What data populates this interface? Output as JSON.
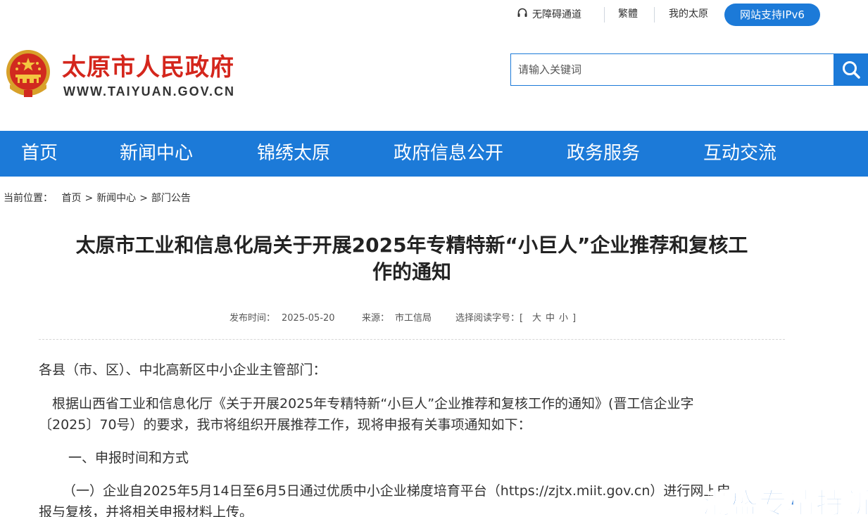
{
  "topbar": {
    "accessibility": "无障碍通道",
    "traditional": "繁體",
    "my_city": "我的太原",
    "ipv6": "网站支持IPv6"
  },
  "header": {
    "site_name": "太原市人民政府",
    "site_url": "WWW.TAIYUAN.GOV.CN"
  },
  "search": {
    "placeholder": "请输入关键词"
  },
  "nav": {
    "items": [
      {
        "label": "首页"
      },
      {
        "label": "新闻中心"
      },
      {
        "label": "锦绣太原"
      },
      {
        "label": "政府信息公开"
      },
      {
        "label": "政务服务"
      },
      {
        "label": "互动交流"
      }
    ]
  },
  "breadcrumb": {
    "prefix": "当前位置：",
    "items": [
      "首页",
      "新闻中心",
      "部门公告"
    ],
    "separator": ">"
  },
  "article": {
    "title_line1": "太原市工业和信息化局关于开展2025年专精特新“小巨人”企业推荐和复核工",
    "title_line2": "作的通知",
    "meta": {
      "date_label": "发布时间：",
      "date": "2025-05-20",
      "source_label": "来源：",
      "source": "市工信局",
      "font_label": "选择阅读字号：[",
      "font_large": "大",
      "font_medium": "中",
      "font_small": "小",
      "font_close": "]"
    },
    "salutation": "各县（市、区）、中北高新区中小企业主管部门：",
    "para1_line1": "根据山西省工业和信息化厅《关于开展2025年专精特新“小巨人”企业推荐和复核工作的通知》(晋工信企业字",
    "para1_line2": "〔2025〕70号）的要求，我市将组织开展推荐工作，现将申报有关事项通知如下：",
    "section1": "一、申报时间和方式",
    "para2_line1": "（一）企业自2025年5月14日至6月5日通过优质中小企业梯度培育平台（https://zjtx.miit.gov.cn）进行网上申",
    "para2_line2": "报与复核，并将相关申报材料上传。"
  },
  "watermark": "潮盛专精特新",
  "colors": {
    "brand_blue": "#1c7ad8",
    "brand_red": "#d4261c"
  }
}
